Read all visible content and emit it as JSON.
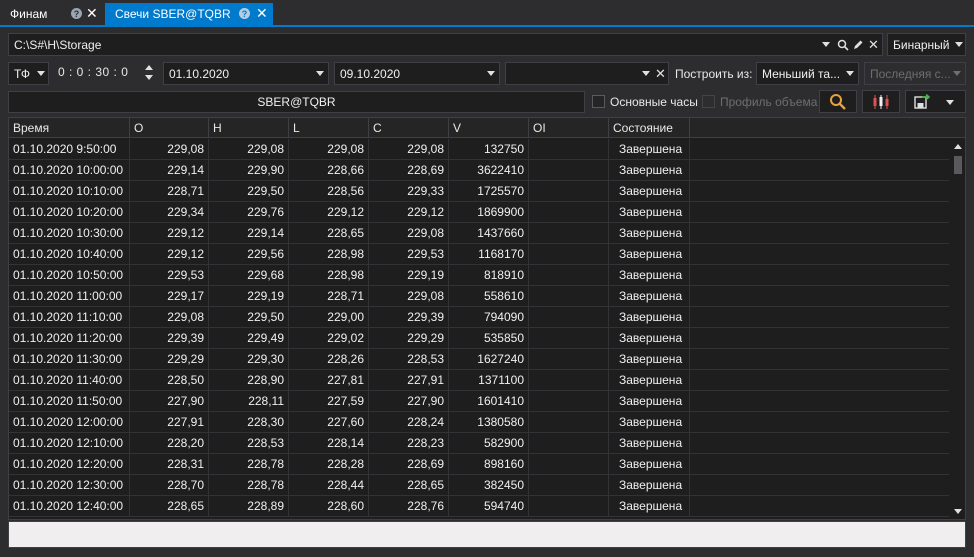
{
  "tabs": [
    {
      "label": "Финам",
      "active": false
    },
    {
      "label": "Свечи SBER@TQBR",
      "active": true
    }
  ],
  "toolbar": {
    "storage_path": "C:\\S#\\H\\Storage",
    "format": "Бинарный",
    "timeframe_type": "ТФ",
    "timeframe_value": "0 : 0 : 30 : 0",
    "date_from": "01.10.2020",
    "date_to": "09.10.2020",
    "build_from_label": "Построить из:",
    "build_from_value": "Меньший та...",
    "last_value": "Последняя с...",
    "security": "SBER@TQBR",
    "main_hours_label": "Основные часы",
    "volume_profile_label": "Профиль объема"
  },
  "colors": {
    "accent": "#007acc",
    "background": "#2d2d30",
    "grid_bg": "#1e1e1e",
    "search_icon": "#e8a33d"
  },
  "icons": [
    "help-icon",
    "close-icon",
    "search-icon",
    "edit-icon",
    "candles-icon",
    "save-icon"
  ],
  "table": {
    "columns": [
      "Время",
      "O",
      "H",
      "L",
      "C",
      "V",
      "OI",
      "Состояние"
    ],
    "rows": [
      [
        "01.10.2020 9:50:00",
        "229,08",
        "229,08",
        "229,08",
        "229,08",
        "132750",
        "",
        "Завершена"
      ],
      [
        "01.10.2020 10:00:00",
        "229,14",
        "229,90",
        "228,66",
        "228,69",
        "3622410",
        "",
        "Завершена"
      ],
      [
        "01.10.2020 10:10:00",
        "228,71",
        "229,50",
        "228,56",
        "229,33",
        "1725570",
        "",
        "Завершена"
      ],
      [
        "01.10.2020 10:20:00",
        "229,34",
        "229,76",
        "229,12",
        "229,12",
        "1869900",
        "",
        "Завершена"
      ],
      [
        "01.10.2020 10:30:00",
        "229,12",
        "229,14",
        "228,65",
        "229,08",
        "1437660",
        "",
        "Завершена"
      ],
      [
        "01.10.2020 10:40:00",
        "229,12",
        "229,56",
        "228,98",
        "229,53",
        "1168170",
        "",
        "Завершена"
      ],
      [
        "01.10.2020 10:50:00",
        "229,53",
        "229,68",
        "228,98",
        "229,19",
        "818910",
        "",
        "Завершена"
      ],
      [
        "01.10.2020 11:00:00",
        "229,17",
        "229,19",
        "228,71",
        "229,08",
        "558610",
        "",
        "Завершена"
      ],
      [
        "01.10.2020 11:10:00",
        "229,08",
        "229,50",
        "229,00",
        "229,39",
        "794090",
        "",
        "Завершена"
      ],
      [
        "01.10.2020 11:20:00",
        "229,39",
        "229,49",
        "229,02",
        "229,29",
        "535850",
        "",
        "Завершена"
      ],
      [
        "01.10.2020 11:30:00",
        "229,29",
        "229,30",
        "228,26",
        "228,53",
        "1627240",
        "",
        "Завершена"
      ],
      [
        "01.10.2020 11:40:00",
        "228,50",
        "228,90",
        "227,81",
        "227,91",
        "1371100",
        "",
        "Завершена"
      ],
      [
        "01.10.2020 11:50:00",
        "227,90",
        "228,11",
        "227,59",
        "227,90",
        "1601410",
        "",
        "Завершена"
      ],
      [
        "01.10.2020 12:00:00",
        "227,91",
        "228,30",
        "227,60",
        "228,24",
        "1380580",
        "",
        "Завершена"
      ],
      [
        "01.10.2020 12:10:00",
        "228,20",
        "228,53",
        "228,14",
        "228,23",
        "582900",
        "",
        "Завершена"
      ],
      [
        "01.10.2020 12:20:00",
        "228,31",
        "228,78",
        "228,28",
        "228,69",
        "898160",
        "",
        "Завершена"
      ],
      [
        "01.10.2020 12:30:00",
        "228,70",
        "228,78",
        "228,44",
        "228,65",
        "382450",
        "",
        "Завершена"
      ],
      [
        "01.10.2020 12:40:00",
        "228,65",
        "228,89",
        "228,60",
        "228,76",
        "594740",
        "",
        "Завершена"
      ]
    ]
  }
}
